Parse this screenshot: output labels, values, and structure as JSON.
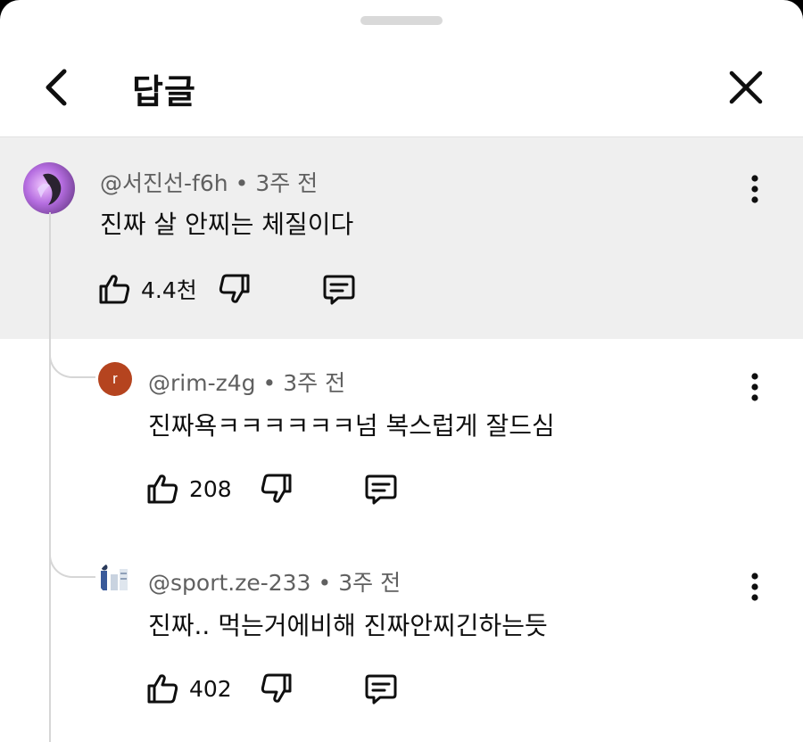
{
  "header": {
    "title": "답글"
  },
  "comments": [
    {
      "author": "@서진선-f6h",
      "time": "3주 전",
      "text": "진짜 살 안찌는 체질이다",
      "likes": "4.4천",
      "avatar_color": "#9b59d0"
    },
    {
      "author": "@rim-z4g",
      "time": "3주 전",
      "text": "진짜욕ㅋㅋㅋㅋㅋㅋ넘 복스럽게 잘드심",
      "likes": "208",
      "avatar_letter": "r",
      "avatar_color": "#b5441f"
    },
    {
      "author": "@sport.ze-233",
      "time": "3주 전",
      "text": "진짜.. 먹는거에비해 진짜안찌긴하는듯",
      "likes": "402"
    }
  ],
  "separator": "•",
  "icons": {
    "back": "chevron-left-icon",
    "close": "close-icon",
    "more": "more-vertical-icon",
    "like": "thumbs-up-icon",
    "dislike": "thumbs-down-icon",
    "reply": "reply-icon"
  }
}
